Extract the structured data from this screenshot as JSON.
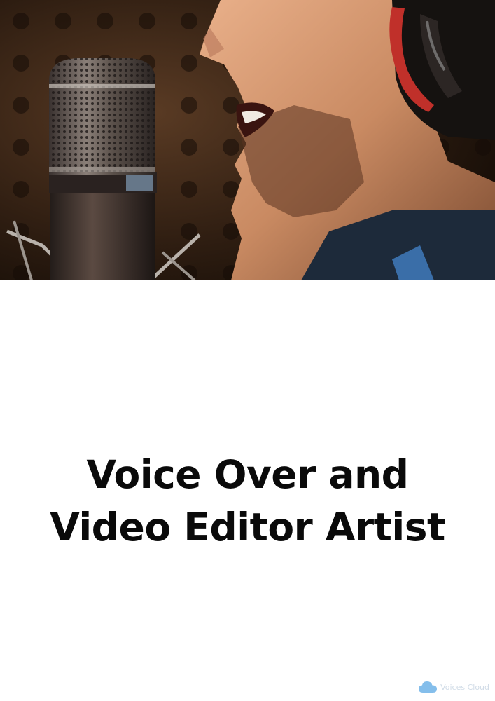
{
  "headline": {
    "line1": "Voice Over and",
    "line2": "Video Editor Artist"
  },
  "watermark": {
    "text": "Voices Cloud",
    "icon": "cloud-icon"
  },
  "colors": {
    "headline": "#0a0a0a",
    "background": "#ffffff",
    "studio_wall": "#2b1c12",
    "watermark_cloud": "#6fb3e8"
  },
  "hero": {
    "icon_names": [
      "studio-microphone",
      "person-singing",
      "headphones"
    ]
  }
}
